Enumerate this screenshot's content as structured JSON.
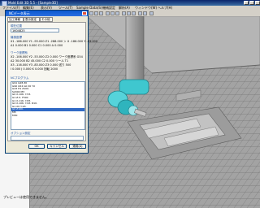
{
  "window": {
    "title": "Mold Edit 3D 5.5 - [Sample3D]"
  },
  "menu": [
    "ファイル(F)",
    "編集(E)",
    "表示(V)",
    "ツール(T)",
    "Sample Data(S)",
    "機械設定",
    "解析(A)",
    "ウィンドウ(W)",
    "ヘルプ(H)"
  ],
  "dialog": {
    "title": "NCデータ表示",
    "tabs": [
      "加工情報",
      "表示設定",
      "その他"
    ],
    "section1_label": "現在位置",
    "field1_value": "1604825",
    "section2_label": "機械座標",
    "coord_rows": [
      "X1 -186.000  Y1  -93.000  Z1 -288.000   ＞   X -186.000  Y -93.000",
      "A1   0.000   B1    0.000   C1    0.000        A   0.000"
    ],
    "section3_label": "ワーク座標系",
    "work_rows": [
      "X2 -106.000  Y2  -53.000  Z2  0.000   ワーク座標系   G54",
      "A2   30.000  B2   45.000  C2  0.000   ツール      T1",
      "X3 -116.000  Y3  -83.000  Z3  0.000   送り       500",
      "I  0.000   J  0.000   K  0.000         回転       2000"
    ],
    "section4_label": "NCプログラム",
    "program_lines": [
      "G91 G28 Z0",
      "G90 G54 G0 X0 Y0",
      "G43 H1 Z100.",
      "S2000 M3",
      "G0 X-106. Y-53.",
      "G1 Z-5. F500",
      "G1 X-116. Y-83.",
      "G2 X-106. Y-93. R10.",
      "G1 X0 Y-93.",
      "G0 Z100.",
      "M5",
      "M30"
    ],
    "selected_line_index": 9,
    "section5_label": "オプション設定",
    "buttons": [
      "OK",
      "キャンセル",
      "適用(A)"
    ]
  },
  "leftpane": {
    "preview_text": "プレビューは使用できません。"
  },
  "colors": {
    "tool_head": "#3fc7cf",
    "machine_gray": "#a8a8a8",
    "floor_grid": "#8c8c8c",
    "fixture": "#b8b8b8"
  }
}
